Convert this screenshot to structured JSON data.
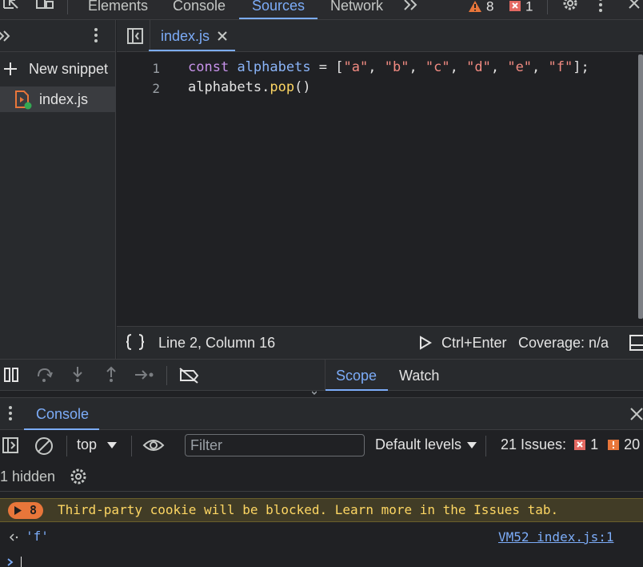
{
  "top_tabs": {
    "elements": "Elements",
    "console": "Console",
    "sources": "Sources",
    "network": "Network"
  },
  "top_badges": {
    "warnings": "8",
    "errors": "1"
  },
  "navigator": {
    "new_snippet": "New snippet",
    "snippet_name": "index.js"
  },
  "editor": {
    "tab_label": "index.js",
    "line_numbers": [
      "1",
      "2"
    ],
    "line1": {
      "keyword": "const",
      "variable": "alphabets",
      "equals": " = [",
      "s1": "\"a\"",
      "s2": "\"b\"",
      "s3": "\"c\"",
      "s4": "\"d\"",
      "s5": "\"e\"",
      "s6": "\"f\"",
      "comma": ", ",
      "end": "];"
    },
    "line2": {
      "object": "alphabets",
      "dot": ".",
      "method": "pop",
      "call": "()"
    }
  },
  "status_bar": {
    "position": "Line 2, Column 16",
    "run_shortcut": "Ctrl+Enter",
    "coverage": "Coverage: n/a"
  },
  "debugger": {
    "scope_tab": "Scope",
    "watch_tab": "Watch"
  },
  "drawer": {
    "tab_label": "Console"
  },
  "console_toolbar": {
    "context": "top",
    "filter_placeholder": "Filter",
    "levels": "Default levels",
    "issues_label": "21 Issues:",
    "issues_errors": "1",
    "issues_warnings": "20",
    "hidden": "1 hidden"
  },
  "console_messages": {
    "warning_count": "8",
    "warning_text": "Third-party cookie will be blocked. Learn more in the Issues tab.",
    "result_value": "'f'",
    "result_source": "VM52 index.js:1"
  },
  "colors": {
    "accent": "#7cacf8",
    "warning": "#e8763a",
    "error": "#f28b82"
  }
}
